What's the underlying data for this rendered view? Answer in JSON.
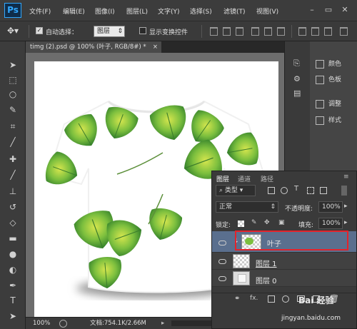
{
  "app": {
    "logo": "Ps"
  },
  "menu": [
    "文件(F)",
    "编辑(E)",
    "图像(I)",
    "图层(L)",
    "文字(Y)",
    "选择(S)",
    "滤镜(T)",
    "视图(V)"
  ],
  "window_controls": [
    "–",
    "▭",
    "✕"
  ],
  "options": {
    "auto_select_label": "自动选择：",
    "auto_select_value": "图层",
    "auto_select_checked": true,
    "show_transform_label": "显示变换控件",
    "show_transform_checked": false
  },
  "document": {
    "tab_title": "timg (2).psd @ 100% (叶子, RGB/8#) *",
    "close": "×"
  },
  "status": {
    "zoom": "100%",
    "doc_size": "文档:754.1K/2.66M"
  },
  "right_panel": {
    "items": [
      {
        "label": "颜色",
        "icon": "color-icon"
      },
      {
        "label": "色板",
        "icon": "swatches-icon"
      },
      {
        "label": "调整",
        "icon": "adjustments-icon"
      },
      {
        "label": "样式",
        "icon": "styles-icon"
      }
    ]
  },
  "layers_panel": {
    "tabs": [
      "图层",
      "通道",
      "路径"
    ],
    "filter_label": "类型",
    "blend_mode": "正常",
    "opacity_label": "不透明度:",
    "opacity_value": "100%",
    "lock_label": "锁定:",
    "fill_label": "填充:",
    "fill_value": "100%",
    "layers": [
      {
        "name": "叶子",
        "selected": true,
        "clipped": true
      },
      {
        "name": "图层 1",
        "selected": false
      },
      {
        "name": "图层 0",
        "selected": false
      }
    ],
    "footer_icons": [
      "link-icon",
      "fx-icon",
      "mask-icon",
      "adjustment-layer-icon",
      "group-icon",
      "new-layer-icon",
      "trash-icon"
    ],
    "fx_text": "fx."
  },
  "watermark": {
    "text": "jingyan.baidu.com",
    "brand": "Bai 经验"
  },
  "colors": {
    "selected_layer": "#5a6f8e",
    "highlight_border": "#e3232b",
    "ps_blue": "#31a8ff",
    "leaf_green": "#3f8f2f",
    "leaf_yellow": "#cfe04a"
  }
}
